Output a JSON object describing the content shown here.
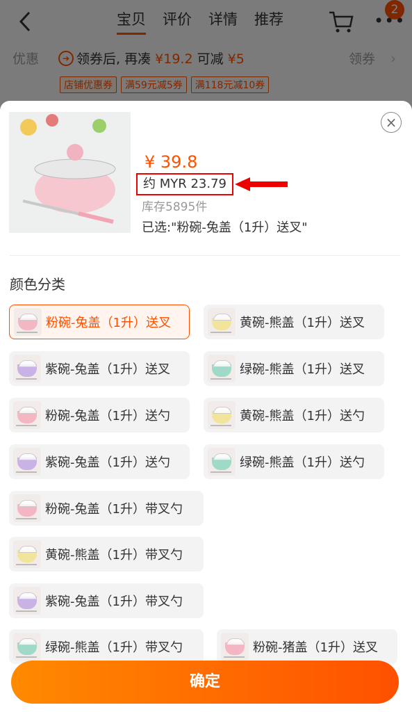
{
  "topnav": {
    "tabs": [
      "宝贝",
      "评价",
      "详情",
      "推荐"
    ],
    "active_tab": 0,
    "cart_badge": "2",
    "more_icon": "more-icon"
  },
  "coupon": {
    "label": "优惠",
    "text_prefix": "领券后, 再凑",
    "amount1": "¥19.2",
    "mid": "可减",
    "amount2": "¥5",
    "get_label": "领券",
    "tags": [
      "店铺优惠券",
      "满59元减5券",
      "满118元减10券"
    ]
  },
  "sheet": {
    "price": "¥ 39.8",
    "myr_price": "约 MYR 23.79",
    "stock": "库存5895件",
    "selected": "已选:\"粉碗-兔盖（1升）送叉\"",
    "section_title": "颜色分类",
    "confirm_label": "确定"
  },
  "options": [
    {
      "name": "粉碗-兔盖（1升）送叉",
      "color": "#f5b6c4",
      "selected": true
    },
    {
      "name": "黄碗-熊盖（1升）送叉",
      "color": "#f2e49a",
      "selected": false
    },
    {
      "name": "紫碗-兔盖（1升）送叉",
      "color": "#c9b3e6",
      "selected": false
    },
    {
      "name": "绿碗-熊盖（1升）送叉",
      "color": "#9fd9c8",
      "selected": false
    },
    {
      "name": "粉碗-兔盖（1升）送勺",
      "color": "#f5b6c4",
      "selected": false
    },
    {
      "name": "黄碗-熊盖（1升）送勺",
      "color": "#f2e49a",
      "selected": false
    },
    {
      "name": "紫碗-兔盖（1升）送勺",
      "color": "#c9b3e6",
      "selected": false
    },
    {
      "name": "绿碗-熊盖（1升）送勺",
      "color": "#9fd9c8",
      "selected": false
    },
    {
      "name": "粉碗-兔盖（1升）带叉勺",
      "color": "#f5b6c4",
      "selected": false
    },
    {
      "name": "黄碗-熊盖（1升）带叉勺",
      "color": "#f2e49a",
      "selected": false
    },
    {
      "name": "紫碗-兔盖（1升）带叉勺",
      "color": "#c9b3e6",
      "selected": false
    },
    {
      "name": "绿碗-熊盖（1升）带叉勺",
      "color": "#9fd9c8",
      "selected": false
    },
    {
      "name": "粉碗-猪盖（1升）送叉",
      "color": "#f5b6c4",
      "selected": false
    }
  ],
  "colors": {
    "accent": "#ff5000",
    "highlight_box": "#e00000"
  }
}
